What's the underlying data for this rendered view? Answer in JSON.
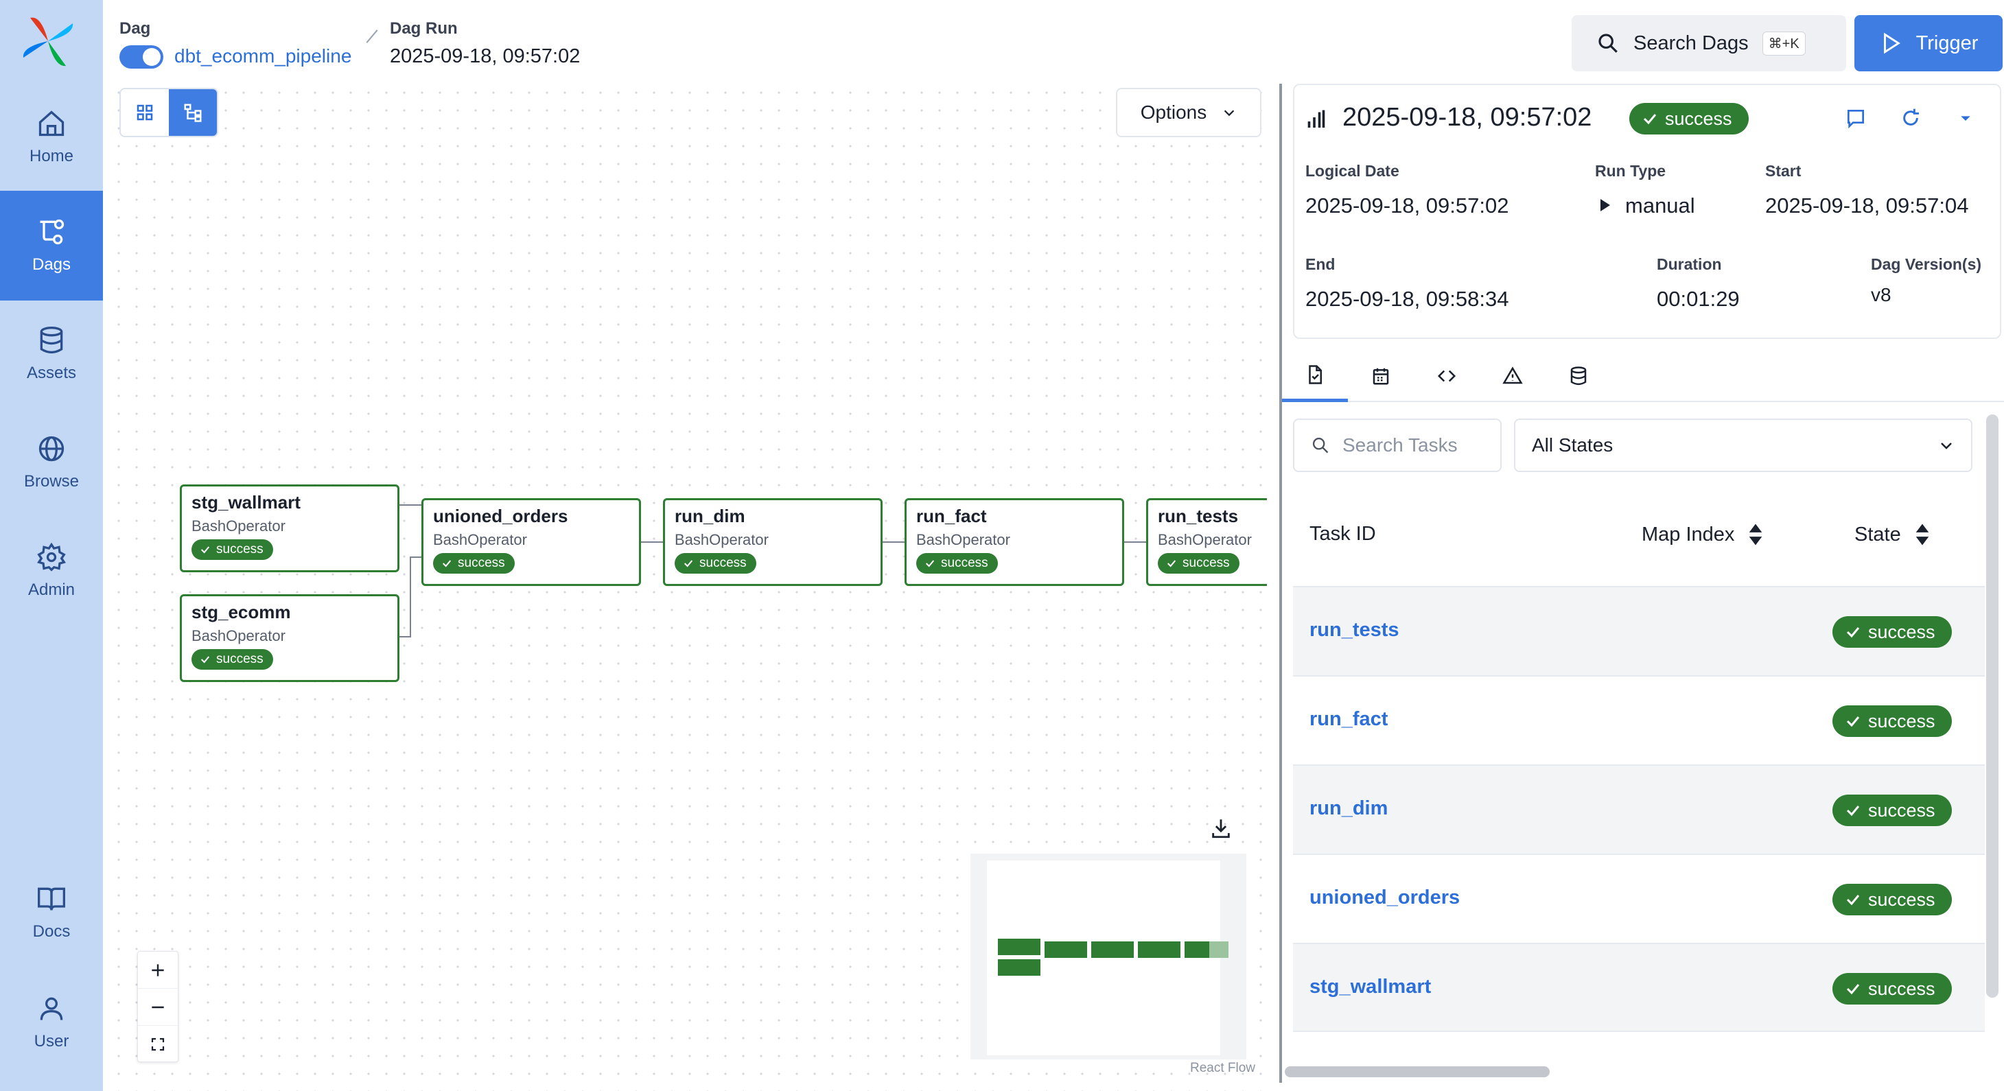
{
  "nav": {
    "home": "Home",
    "dags": "Dags",
    "assets": "Assets",
    "browse": "Browse",
    "admin": "Admin",
    "docs": "Docs",
    "user": "User"
  },
  "breadcrumb": {
    "dag_label": "Dag",
    "dag_name": "dbt_ecomm_pipeline",
    "run_label": "Dag Run",
    "run_value": "2025-09-18, 09:57:02"
  },
  "header": {
    "search_label": "Search Dags",
    "search_shortcut": "⌘+K",
    "trigger_label": "Trigger"
  },
  "graph": {
    "options_label": "Options",
    "attribution": "React Flow",
    "nodes": [
      {
        "name": "stg_wallmart",
        "operator": "BashOperator",
        "state": "success"
      },
      {
        "name": "stg_ecomm",
        "operator": "BashOperator",
        "state": "success"
      },
      {
        "name": "unioned_orders",
        "operator": "BashOperator",
        "state": "success"
      },
      {
        "name": "run_dim",
        "operator": "BashOperator",
        "state": "success"
      },
      {
        "name": "run_fact",
        "operator": "BashOperator",
        "state": "success"
      },
      {
        "name": "run_tests",
        "operator": "BashOperator",
        "state": "success"
      }
    ]
  },
  "run_details": {
    "title": "2025-09-18, 09:57:02",
    "status": "success",
    "logical_date_label": "Logical Date",
    "logical_date": "2025-09-18, 09:57:02",
    "run_type_label": "Run Type",
    "run_type": "manual",
    "start_label": "Start",
    "start": "2025-09-18, 09:57:04",
    "end_label": "End",
    "end": "2025-09-18, 09:58:34",
    "duration_label": "Duration",
    "duration": "00:01:29",
    "version_label": "Dag Version(s)",
    "version": "v8"
  },
  "task_table": {
    "search_placeholder": "Search Tasks",
    "state_filter": "All States",
    "columns": {
      "task_id": "Task ID",
      "map_index": "Map Index",
      "state": "State"
    },
    "rows": [
      {
        "task_id": "run_tests",
        "state": "success"
      },
      {
        "task_id": "run_fact",
        "state": "success"
      },
      {
        "task_id": "run_dim",
        "state": "success"
      },
      {
        "task_id": "unioned_orders",
        "state": "success"
      },
      {
        "task_id": "stg_wallmart",
        "state": "success"
      }
    ]
  },
  "colors": {
    "sidebar_bg": "#c3d8f5",
    "accent": "#3f7de2",
    "success": "#2e7d32",
    "link": "#2d6fd8"
  }
}
